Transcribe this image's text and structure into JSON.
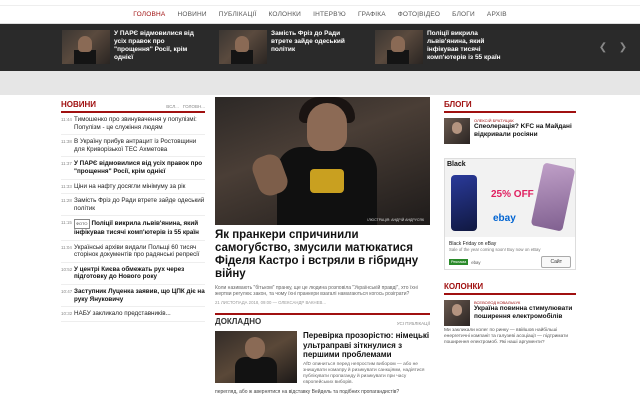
{
  "nav": {
    "items": [
      "ГОЛОВНА",
      "НОВИНИ",
      "ПУБЛІКАЦІЇ",
      "КОЛОНКИ",
      "ІНТЕРВ'Ю",
      "ГРАФІКА",
      "ФОТО|ВІДЕО",
      "БЛОГИ",
      "АРХІВ"
    ]
  },
  "ticker": {
    "items": [
      "У ПАРЄ відмовилися від усіх правок про \"прощення\" Росії, крім однієї",
      "Замість Фріз до Ради втрете зайде одеський політик",
      "Поліції викрила львів'янина, який інфікував тисячі комп'ютерів із 55 країн"
    ]
  },
  "news": {
    "title": "НОВИНИ",
    "tab_latest": "ВСЛ...",
    "tab_main": "ГОЛОВН...",
    "items": [
      {
        "time": "11:44",
        "text": "Тимошенко про звинувачення у популізмі: Популізм - це служіння людям",
        "bold": false
      },
      {
        "time": "11:38",
        "text": "В Україну прибув антрацит із Ростовщини для Криворізької ТЕС Ахметова",
        "bold": false
      },
      {
        "time": "11:37",
        "text": "У ПАРЄ відмовилися від усіх правок про \"прощення\" Росії, крім однієї",
        "bold": true
      },
      {
        "time": "11:33",
        "text": "Ціни на нафту досягли мінімуму за рік",
        "bold": false
      },
      {
        "time": "11:28",
        "text": "Замість Фріз до Ради втрете зайде одеський політик",
        "bold": false
      },
      {
        "time": "11:15",
        "tag": "ФОТО",
        "text": "Поліції викрила львів'янина, який інфікував тисячі комп'ютерів із 55 країн",
        "bold": true
      },
      {
        "time": "11:04",
        "text": "Українські архіви видали Польщі 60 тисяч сторінок документів про радянські репресії",
        "bold": false
      },
      {
        "time": "10:52",
        "text": "У центрі Києва обмежать рух через підготовку до Нового року",
        "bold": true
      },
      {
        "time": "10:47",
        "text": "Заступник Луценка заявив, що ЦПК діє на руку Януковичу",
        "bold": true
      },
      {
        "time": "10:32",
        "text": "НАБУ закликало представників...",
        "bold": false
      }
    ]
  },
  "main": {
    "credit": "ІЛЮСТРАЦІЯ: АНДРІЙ АНДРУСЯК",
    "title": "Як пранкери спричинили самогубство, змусили матюкатися Фіделя Кастро і встряли в гібридну війну",
    "lead": "Коли називають \"бітьком\" пранку, ще це людина розповіла \"Українській правді\", хто їхні жертви регулює закон, та чому їхні пранкери взагалі намагаються когось розіграти?",
    "meta": "21 ЛИСТОПАДА 2018, 09:00 — ОЛЕКСАНДР ВАКНЕВ..."
  },
  "detail": {
    "title": "ДОКЛАДНО",
    "subtitle": "УСІ ПУБЛІКАЦІЇ",
    "item_title": "Перевірка прозорістю: німецькі ультраправі зіткнулися з першими проблемами",
    "item_lead": "AfD опиниться перед непростим вибором — або не знищувати комапру й ризикувати санкціями, надіятися публікувати пропаганду й ризикувати при часу європейських виборів.",
    "bottom": "перегляд, або ж авернятися на відставку Вейдель та подібних пропагандистів?"
  },
  "blogs": {
    "title": "БЛОГИ",
    "author": "ОЛЕКСІЙ БРАТУЩАК",
    "post_title": "Спеолерація? KFC на Майдані відкривали росіяни"
  },
  "ad": {
    "headline": "Black Friday on eBay",
    "subline": "Sale of the year coming soon! Buy now on eBay",
    "domain": "ebay",
    "badge": "Реклама",
    "button": "Сайт",
    "promo_black": "Black",
    "promo_pct": "25% OFF",
    "logo": "ebay"
  },
  "columns": {
    "title": "КОЛОНКИ",
    "author": "ВСЕВОЛОД КОВАЛЬЧУК",
    "post_title": "Україна повинна стимулювати поширення електромобілів",
    "lead": "Ми закликали колег по ринку — ввійшов найбільші енергетичні компанії та галузеві асоціації — підтримати поширення електромоб. Які наші аргументи?"
  }
}
